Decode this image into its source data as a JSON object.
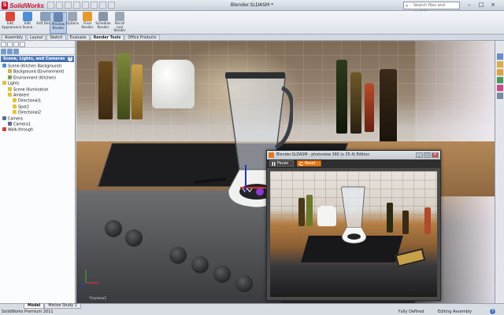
{
  "app": {
    "logo_mark": "S",
    "logo_text": "SolidWorks",
    "doc_title": "Blender.SLDASM *",
    "search_placeholder": "Search files and models",
    "search_icon": "search-icon",
    "win_minimize": "–",
    "win_restore": "□",
    "win_close": "×"
  },
  "ribbon": {
    "buttons": [
      {
        "label": "Edit Appearance",
        "icon": "appearance-icon",
        "color": "#d8473a"
      },
      {
        "label": "Edit Scene",
        "icon": "scene-icon",
        "color": "#4d8fd1"
      },
      {
        "label": "Edit Decal",
        "icon": "decal-icon",
        "color": "#8aa0b8"
      },
      {
        "label": "Preview Render",
        "icon": "preview-render-icon",
        "color": "#6b87b0"
      },
      {
        "label": "Options",
        "icon": "options-icon",
        "color": "#9aa6b3"
      },
      {
        "label": "Final Render",
        "icon": "final-render-icon",
        "color": "#e59a2b"
      },
      {
        "label": "Schedule Render",
        "icon": "schedule-icon",
        "color": "#8896a8"
      },
      {
        "label": "Recall Last Render",
        "icon": "recall-icon",
        "color": "#9ba7b5"
      }
    ]
  },
  "tabs": [
    {
      "label": "Assembly",
      "active": false
    },
    {
      "label": "Layout",
      "active": false
    },
    {
      "label": "Sketch",
      "active": false
    },
    {
      "label": "Evaluate",
      "active": false
    },
    {
      "label": "Render Tools",
      "active": true
    },
    {
      "label": "Office Products",
      "active": false
    }
  ],
  "panel": {
    "header": "Scene, Lights, and Cameras",
    "help": "?",
    "tree": [
      {
        "label": "Scene (Kitchen Background)",
        "indent": 0,
        "color": "#4d8fd1"
      },
      {
        "label": "Background (Environment)",
        "indent": 1,
        "color": "#d8b04a"
      },
      {
        "label": "Environment (Kitchen)",
        "indent": 1,
        "color": "#7aa05a"
      },
      {
        "label": "Lights",
        "indent": 0,
        "color": "#e2c23a"
      },
      {
        "label": "Scene Illumination",
        "indent": 1,
        "color": "#e2c23a"
      },
      {
        "label": "Ambient",
        "indent": 1,
        "color": "#e2c23a"
      },
      {
        "label": "Directional1",
        "indent": 2,
        "color": "#e2c23a"
      },
      {
        "label": "Spot2",
        "indent": 2,
        "color": "#e2c23a"
      },
      {
        "label": "Directional2",
        "indent": 2,
        "color": "#e2c23a"
      },
      {
        "label": "Camera",
        "indent": 0,
        "color": "#5a6f8e"
      },
      {
        "label": "Camera1",
        "indent": 1,
        "color": "#5a6f8e"
      },
      {
        "label": "Walk-through",
        "indent": 0,
        "color": "#c7473a"
      }
    ]
  },
  "viewport": {
    "triad_label": "*Camera1"
  },
  "photoview": {
    "title": "Blender.SLDASM - photoview 360 (v 35.4) Edition",
    "pause_label": "Pause",
    "reset_label": "Reset",
    "min": "_",
    "max": "□",
    "close": "×"
  },
  "statusbar": {
    "tabs": [
      {
        "label": "Model",
        "active": true
      },
      {
        "label": "Motion Study 1",
        "active": false
      }
    ],
    "product": "SolidWorks Premium 2011",
    "state": "Fully Defined",
    "mode": "Editing Assembly",
    "help": "?"
  }
}
